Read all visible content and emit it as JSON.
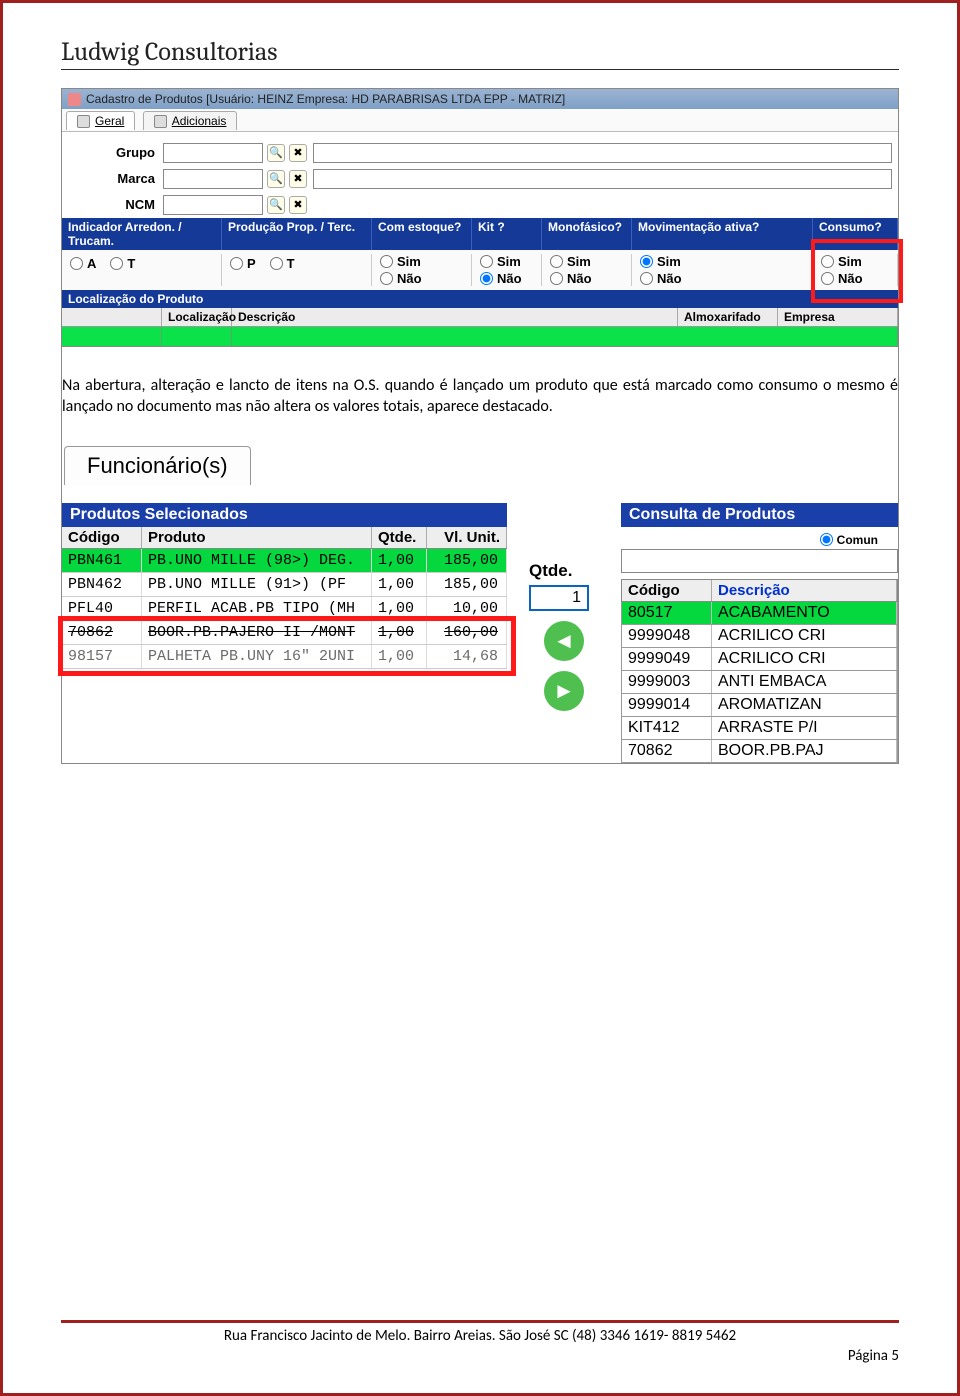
{
  "doc_header": "Ludwig Consultorias",
  "window_title": "Cadastro de Produtos [Usuário: HEINZ  Empresa: HD PARABRISAS LTDA EPP - MATRIZ]",
  "tabs": {
    "geral": "Geral",
    "adicionais": "Adicionais"
  },
  "form": {
    "grupo_label": "Grupo",
    "grupo_val": "",
    "marca_label": "Marca",
    "marca_val": "",
    "ncm_label": "NCM",
    "ncm_val": ""
  },
  "blue_headers": {
    "a": "Indicador Arredon. / Trucam.",
    "b": "Produção Prop. / Terc.",
    "c": "Com estoque?",
    "d": "Kit ?",
    "e": "Monofásico?",
    "f": "Movimentação ativa?",
    "g": "Consumo?"
  },
  "opts": {
    "a1": "A",
    "a2": "T",
    "b1": "P",
    "b2": "T",
    "sim": "Sim",
    "nao": "Não"
  },
  "loc_title": "Localização do Produto",
  "loc_cols": {
    "blank": "",
    "localizacao": "Localização",
    "descricao": "Descrição",
    "almox": "Almoxarifado",
    "empresa": "Empresa"
  },
  "paragraph": "Na abertura, alteração e lancto de itens na O.S. quando é lançado um produto que está marcado como consumo o mesmo é lançado no documento mas não  altera os valores totais, aparece destacado.",
  "shot2": {
    "functab": "Funcionário(s)",
    "left_title": "Produtos Selecionados",
    "cols": {
      "codigo": "Código",
      "produto": "Produto",
      "qtde": "Qtde.",
      "vlunit": "Vl. Unit."
    },
    "rows": [
      {
        "codigo": "PBN461",
        "produto": "PB.UNO MILLE (98>) DEG.",
        "qtde": "1,00",
        "vl": "185,00",
        "cls": "green"
      },
      {
        "codigo": "PBN462",
        "produto": "PB.UNO MILLE (91>) (PF",
        "qtde": "1,00",
        "vl": "185,00",
        "cls": ""
      },
      {
        "codigo": "PFL40",
        "produto": "PERFIL ACAB.PB TIPO (MH",
        "qtde": "1,00",
        "vl": "10,00",
        "cls": ""
      },
      {
        "codigo": "70862",
        "produto": "BOOR.PB.PAJERO II /MONT",
        "qtde": "1,00",
        "vl": "160,00",
        "cls": "strike"
      },
      {
        "codigo": "98157",
        "produto": "PALHETA PB.UNY 16\" 2UNI",
        "qtde": "1,00",
        "vl": "14,68",
        "cls": "gray"
      }
    ],
    "qtde_label": "Qtde.",
    "qtde_val": "1",
    "right_title": "Consulta de Produtos",
    "comun": "Comun",
    "rcols": {
      "codigo": "Código",
      "descr": "Descrição"
    },
    "rright": [
      {
        "codigo": "80517",
        "desc": "ACABAMENTO",
        "cls": "green"
      },
      {
        "codigo": "9999048",
        "desc": "ACRILICO CRI",
        "cls": ""
      },
      {
        "codigo": "9999049",
        "desc": "ACRILICO CRI",
        "cls": ""
      },
      {
        "codigo": "9999003",
        "desc": "ANTI EMBACA",
        "cls": ""
      },
      {
        "codigo": "9999014",
        "desc": "AROMATIZAN",
        "cls": ""
      },
      {
        "codigo": "KIT412",
        "desc": "ARRASTE P/I",
        "cls": ""
      },
      {
        "codigo": "70862",
        "desc": "BOOR.PB.PAJ",
        "cls": ""
      }
    ]
  },
  "footer": {
    "line": "Rua Francisco Jacinto de Melo. Bairro Areias. São José SC (48) 3346 1619- 8819 5462",
    "page": "Página 5"
  }
}
